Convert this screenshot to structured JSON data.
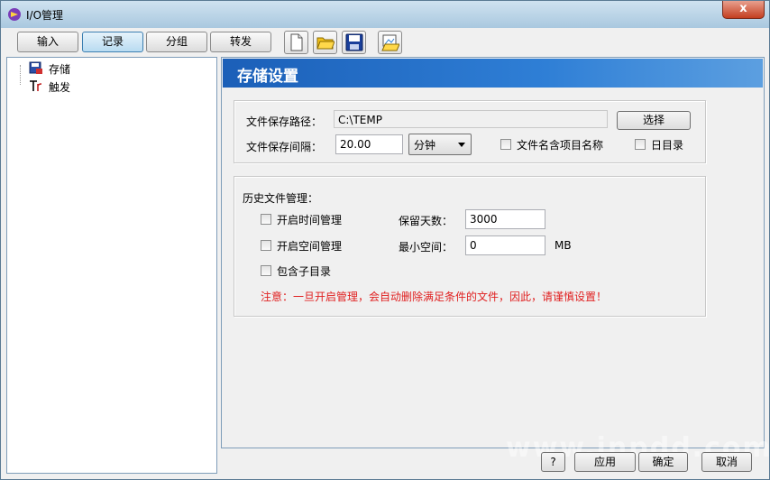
{
  "window": {
    "title": "I/O管理",
    "close_label": "x"
  },
  "tabs": [
    {
      "label": "输入",
      "active": false
    },
    {
      "label": "记录",
      "active": true
    },
    {
      "label": "分组",
      "active": false
    },
    {
      "label": "转发",
      "active": false
    }
  ],
  "toolbar": {
    "icons": [
      "new-file-icon",
      "open-folder-icon",
      "save-disk-icon",
      "import-image-icon"
    ]
  },
  "tree": {
    "items": [
      {
        "label": "存储",
        "icon": "storage-disk-icon"
      },
      {
        "label": "触发",
        "icon": "trigger-icon"
      }
    ]
  },
  "panel": {
    "title": "存储设置"
  },
  "storage": {
    "path_label": "文件保存路径：",
    "path_value": "C:\\TEMP",
    "select_button": "选择",
    "interval_label": "文件保存间隔：",
    "interval_value": "20.00",
    "unit_value": "分钟",
    "filename_option_label": "文件名含项目名称",
    "day_dir_label": "日目录"
  },
  "history": {
    "group_label": "历史文件管理：",
    "time_mgmt_label": "开启时间管理",
    "space_mgmt_label": "开启空间管理",
    "subdir_label": "包含子目录",
    "keep_days_label": "保留天数：",
    "keep_days_value": "3000",
    "min_space_label": "最小空间：",
    "min_space_value": "0",
    "min_space_unit": "MB",
    "warning": "注意：一旦开启管理，会自动删除满足条件的文件，因此，请谨慎设置！"
  },
  "footer": {
    "help_label": "?",
    "apply_label": "应用",
    "ok_label": "确定",
    "cancel_label": "取消"
  },
  "watermark": "www.jnpdd.com"
}
